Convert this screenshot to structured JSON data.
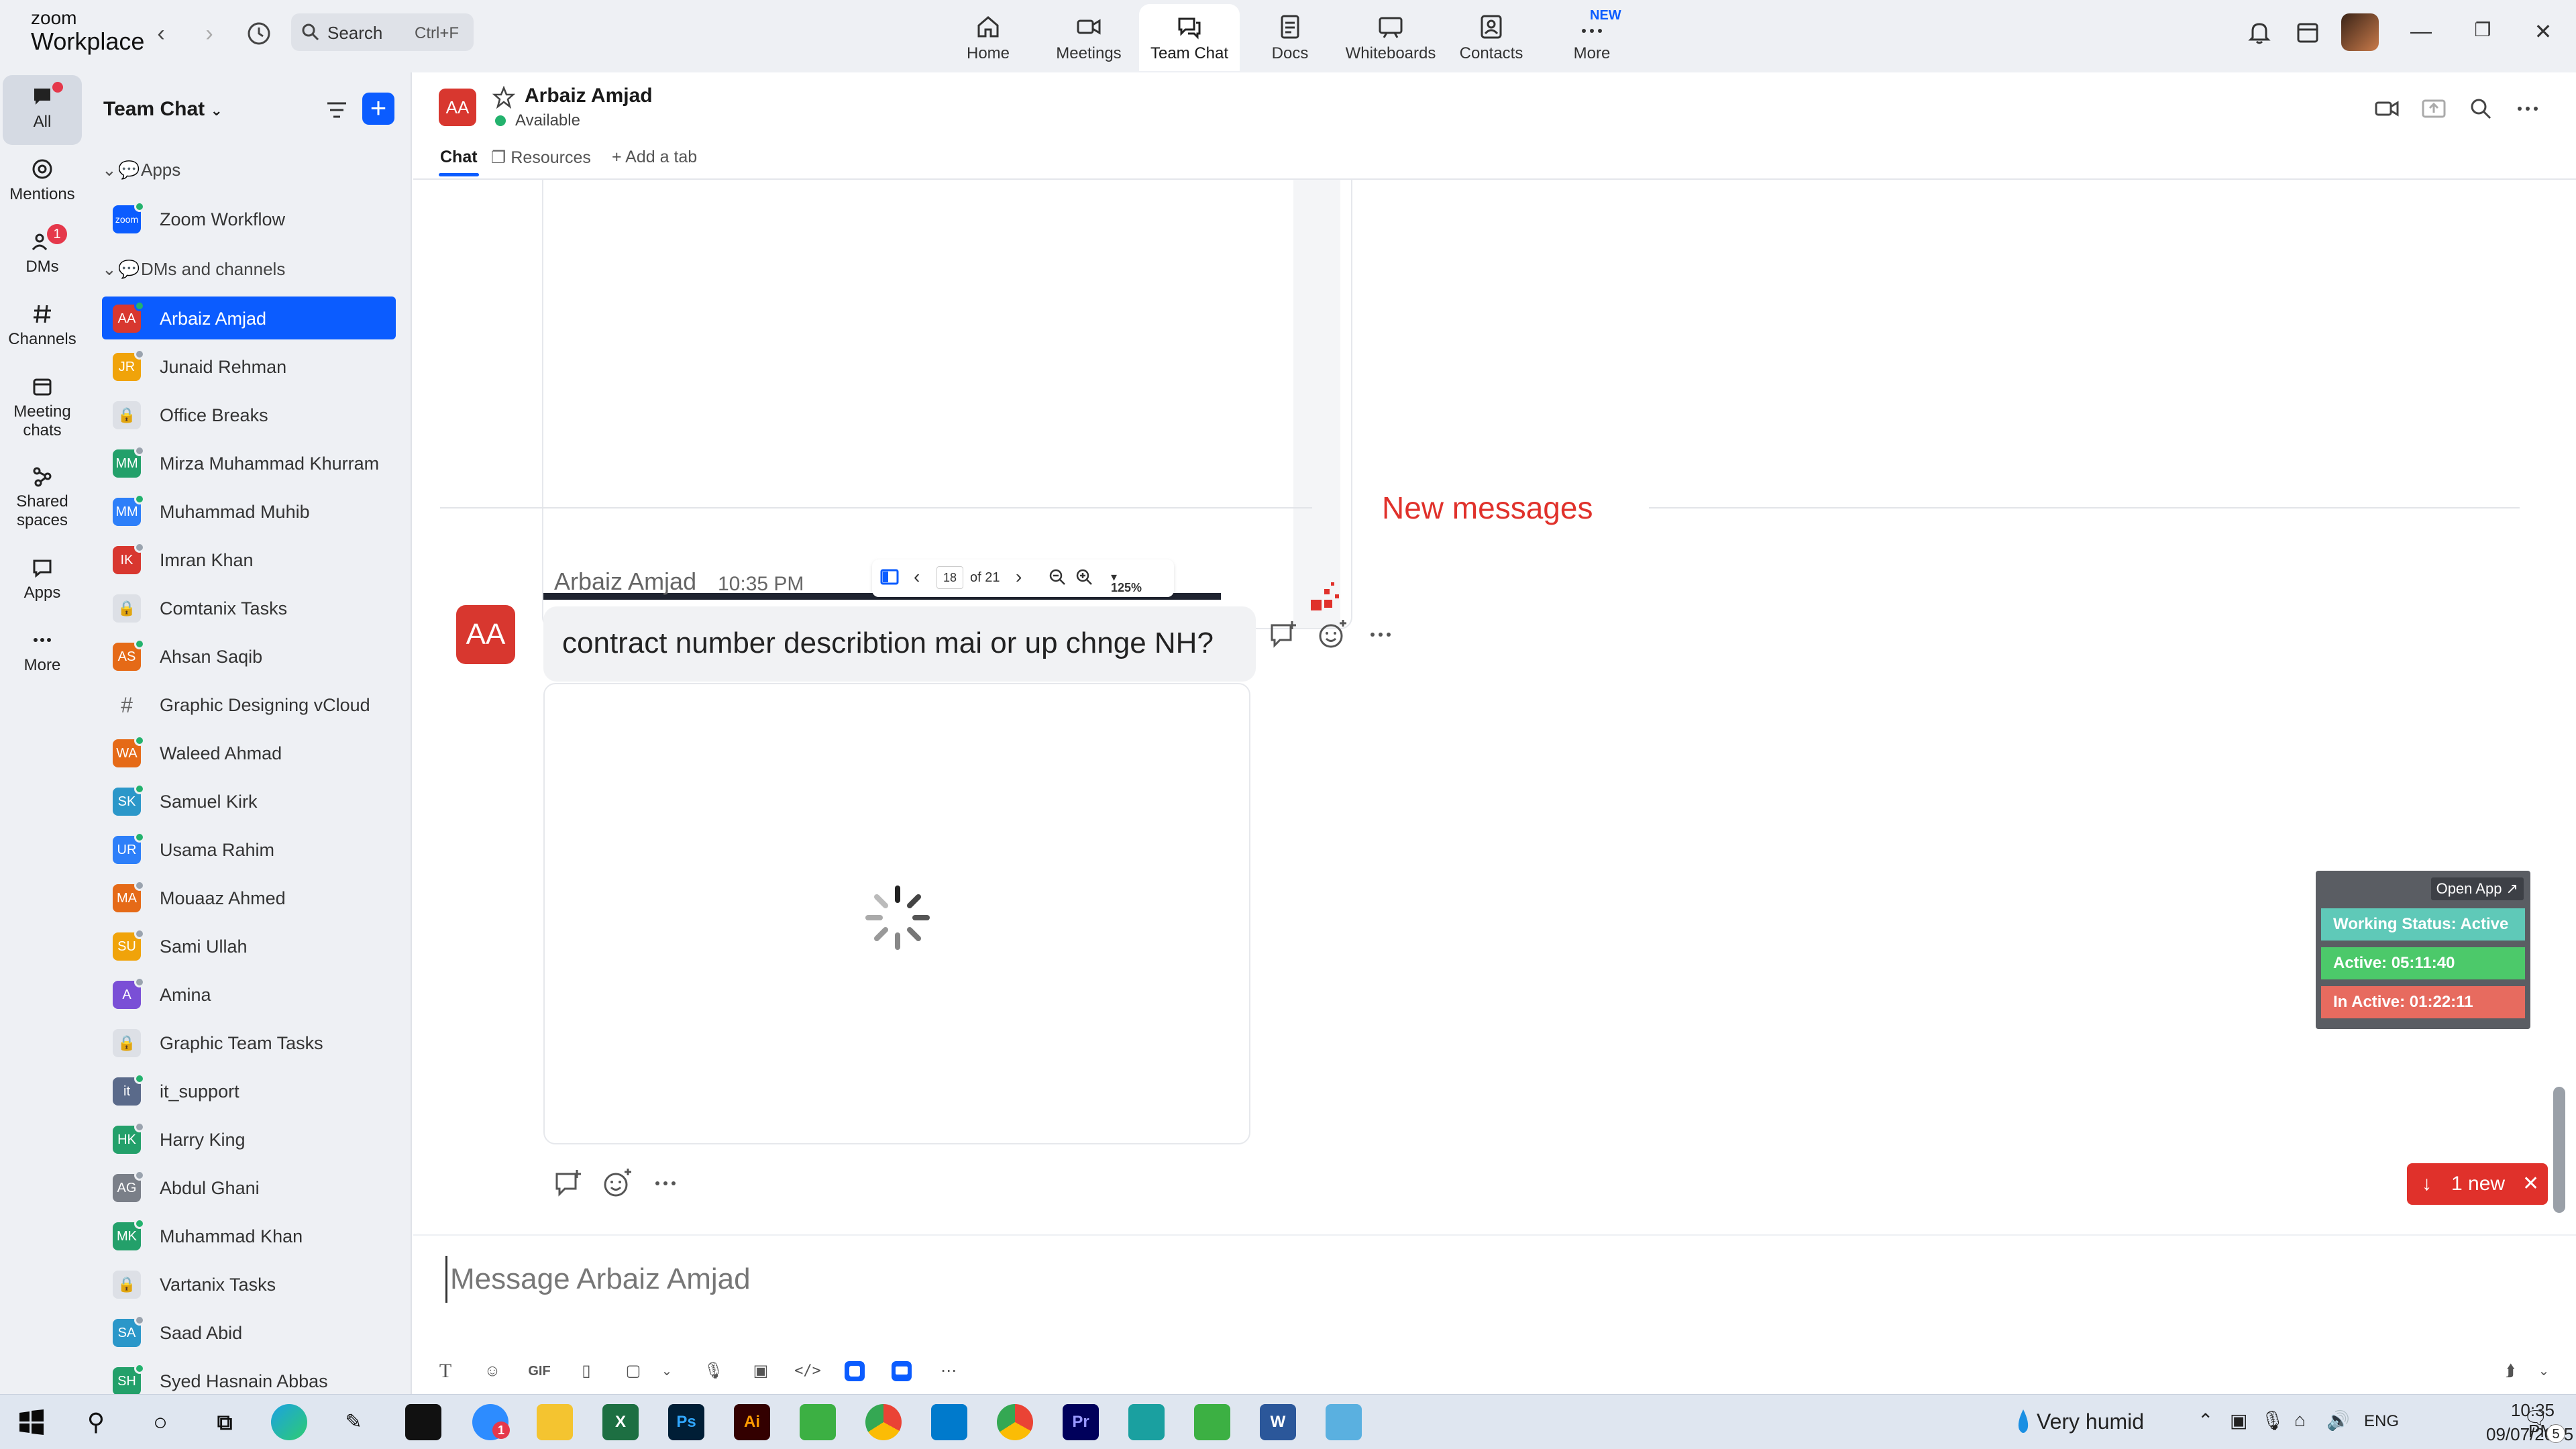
{
  "app": {
    "logo_top": "zoom",
    "logo_bottom": "Workplace"
  },
  "topbar": {
    "search_placeholder": "Search",
    "search_shortcut": "Ctrl+F",
    "tabs": [
      {
        "label": "Home",
        "icon": "home-icon"
      },
      {
        "label": "Meetings",
        "icon": "video-camera-icon"
      },
      {
        "label": "Team Chat",
        "icon": "chat-bubbles-icon"
      },
      {
        "label": "Docs",
        "icon": "doc-icon"
      },
      {
        "label": "Whiteboards",
        "icon": "whiteboard-icon"
      },
      {
        "label": "Contacts",
        "icon": "contacts-icon"
      },
      {
        "label": "More",
        "icon": "more-icon"
      }
    ],
    "active_tab": "Team Chat",
    "new_badge": "NEW"
  },
  "rail": {
    "items": [
      {
        "label": "All",
        "icon": "chat-icon"
      },
      {
        "label": "Mentions",
        "icon": "at-icon"
      },
      {
        "label": "DMs",
        "icon": "people-icon",
        "badge": "1"
      },
      {
        "label": "Channels",
        "icon": "hash-icon"
      },
      {
        "label": "Meeting chats",
        "icon": "calendar-icon"
      },
      {
        "label": "Shared spaces",
        "icon": "shared-spaces-icon"
      },
      {
        "label": "Apps",
        "icon": "apps-icon"
      },
      {
        "label": "More",
        "icon": "ellipsis-icon"
      }
    ]
  },
  "sidebar": {
    "title": "Team Chat",
    "sections": {
      "apps": "Apps",
      "dms": "DMs and channels"
    },
    "apps": [
      {
        "name": "Zoom Workflow",
        "initials": "zoom",
        "color": "#0b5cff"
      }
    ],
    "items": [
      {
        "name": "Arbaiz Amjad",
        "initials": "AA",
        "color": "#d8372f",
        "type": "dm",
        "presence": "online"
      },
      {
        "name": "Junaid Rehman",
        "initials": "JR",
        "color": "#f0a30a",
        "type": "dm",
        "presence": "away"
      },
      {
        "name": "Office Breaks",
        "type": "locked"
      },
      {
        "name": "Mirza Muhammad Khurram",
        "initials": "MM",
        "color": "#23a06a",
        "type": "dm",
        "presence": "away"
      },
      {
        "name": "Muhammad Muhib",
        "initials": "MM",
        "color": "#2d7ff9",
        "type": "dm",
        "presence": "online"
      },
      {
        "name": "Imran Khan",
        "initials": "IK",
        "color": "#d8372f",
        "type": "dm",
        "presence": "away"
      },
      {
        "name": "Comtanix Tasks",
        "type": "locked"
      },
      {
        "name": "Ahsan Saqib",
        "initials": "AS",
        "color": "#e56a17",
        "type": "dm",
        "presence": "online"
      },
      {
        "name": "Graphic Designing vCloud",
        "type": "channel"
      },
      {
        "name": "Waleed Ahmad",
        "initials": "WA",
        "color": "#e56a17",
        "type": "dm",
        "presence": "online"
      },
      {
        "name": "Samuel Kirk",
        "initials": "SK",
        "color": "#2b97c9",
        "type": "dm",
        "presence": "online"
      },
      {
        "name": "Usama Rahim",
        "initials": "UR",
        "color": "#2d7ff9",
        "type": "dm",
        "presence": "online"
      },
      {
        "name": "Mouaaz Ahmed",
        "initials": "MA",
        "color": "#e56a17",
        "type": "dm",
        "presence": "away"
      },
      {
        "name": "Sami Ullah",
        "initials": "SU",
        "color": "#f0a30a",
        "type": "dm",
        "presence": "away"
      },
      {
        "name": "Amina",
        "initials": "A",
        "color": "#7a4fd6",
        "type": "dm",
        "presence": "away"
      },
      {
        "name": "Graphic Team Tasks",
        "type": "locked"
      },
      {
        "name": "it_support",
        "initials": "it",
        "color": "#5a6a8a",
        "type": "dm",
        "presence": "online"
      },
      {
        "name": "Harry King",
        "initials": "HK",
        "color": "#23a06a",
        "type": "dm",
        "presence": "away"
      },
      {
        "name": "Abdul Ghani",
        "initials": "AG",
        "color": "#7a7f88",
        "type": "dm",
        "presence": "away"
      },
      {
        "name": "Muhammad Khan",
        "initials": "MK",
        "color": "#23a06a",
        "type": "dm",
        "presence": "online"
      },
      {
        "name": "Vartanix Tasks",
        "type": "locked"
      },
      {
        "name": "Saad Abid",
        "initials": "SA",
        "color": "#2b97c9",
        "type": "dm",
        "presence": "away"
      },
      {
        "name": "Syed Hasnain Abbas",
        "initials": "SH",
        "color": "#23a06a",
        "type": "dm",
        "presence": "online"
      }
    ]
  },
  "chat": {
    "initials": "AA",
    "name": "Arbaiz Amjad",
    "status": "Available",
    "tabs": [
      "Chat",
      "Resources",
      "+ Add a tab"
    ]
  },
  "pdf_viewer": {
    "page": "18",
    "of_total": "of 21",
    "zoom": "125%"
  },
  "messages": {
    "divider": "New messages",
    "sender": "Arbaiz Amjad",
    "time": "10:35 PM",
    "initials": "AA",
    "text": "contract number describtion mai or up chnge NH?"
  },
  "tracker": {
    "open_app": "Open App ↗",
    "working_status": "Working Status: Active",
    "active": "Active: 05:11:40",
    "inactive": "In Active: 01:22:11"
  },
  "new_pill": {
    "label": "1 new"
  },
  "composer": {
    "placeholder": "Message Arbaiz Amjad",
    "value": "",
    "tools": [
      "format-text-icon",
      "emoji-icon",
      "gif-icon",
      "file-icon",
      "screenshot-icon",
      "audio-icon",
      "video-clip-icon",
      "code-icon",
      "app-icon",
      "app-icon",
      "more-icon"
    ],
    "gif_label": "GIF"
  },
  "taskbar": {
    "weather": "Very humid",
    "lang": "ENG",
    "time": "10:35 PM",
    "date": "09/07/2025",
    "notification_count": "5",
    "zoom_badge": "1",
    "apps": [
      "Ps",
      "Ai",
      "Pr"
    ]
  }
}
